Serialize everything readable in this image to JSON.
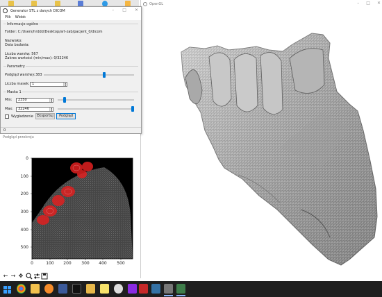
{
  "generator": {
    "title": "Generator STL z danych DICOM",
    "menu": [
      "Plik",
      "Widok"
    ],
    "general": {
      "heading": "Informacje ogólne",
      "folder": "Folder: C:/Users/hrddd/Desktop/art-zab/pacjent_0/dicom",
      "surname": "Nazwisko:",
      "exam_date": "Data badania:",
      "layer_count": "Liczba warstw: 567",
      "value_range": "Zakres wartości (min/max): 0/32246"
    },
    "params": {
      "heading": "Parametry",
      "layer_preview_label": "Podgląd warstwy:",
      "layer_preview_value": "383",
      "layer_preview_fraction": 0.675,
      "mask_count_label": "Liczba masek:",
      "mask_count_value": "1"
    },
    "mask": {
      "heading": "Maska 1",
      "min_label": "Min:",
      "min_value": "2350",
      "min_fraction": 0.073,
      "max_label": "Max:",
      "max_value": "32246",
      "max_fraction": 1.0
    },
    "smoothing_label": "Wygładzenie",
    "smoothing_checked": false,
    "export_label": "Eksportuj",
    "preview_label": "Podgląd",
    "status": "0"
  },
  "opengl": {
    "title": "OpenGL",
    "controls": [
      "–",
      "□",
      "✕"
    ]
  },
  "preview_window": {
    "title": "Podgląd przekroju",
    "y_ticks": [
      "0",
      "100",
      "200",
      "300",
      "400",
      "500"
    ],
    "x_ticks": [
      "0",
      "100",
      "200",
      "300",
      "400",
      "500"
    ]
  },
  "colors": {
    "accent": "#0078d7",
    "mask_overlay": "#e02020",
    "taskbar": "#1f1f1f"
  },
  "toolbar_icons": [
    "arrow-left-icon",
    "arrow-right-icon",
    "pan-icon",
    "zoom-icon",
    "configure-icon",
    "save-icon"
  ],
  "taskbar_icons": [
    "windows-start-icon",
    "chrome-icon",
    "folder-icon",
    "blender-icon",
    "settings-app-icon",
    "terminal-icon",
    "folder-icon-2",
    "sticky-notes-icon",
    "unreal-icon",
    "visual-studio-icon",
    "app-icon-red",
    "python-icon",
    "app-icon-gray",
    "stl-generator-icon"
  ]
}
